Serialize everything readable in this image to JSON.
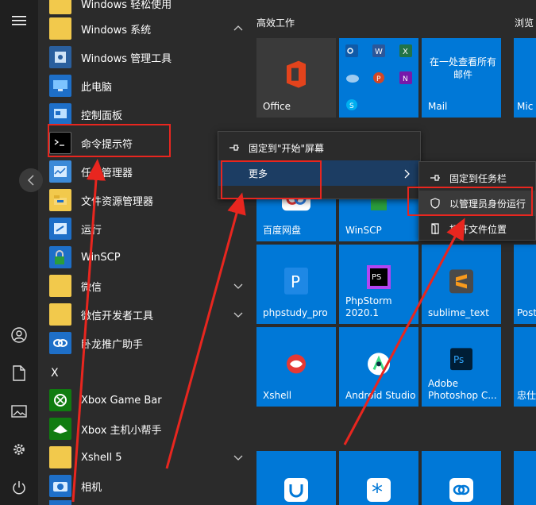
{
  "app_list": {
    "rows": [
      {
        "label": "Windows 轻松使用",
        "icon": "folder-icon"
      },
      {
        "label": "Windows 系统",
        "icon": "folder-icon",
        "chevron": "up"
      },
      {
        "label": "Windows 管理工具",
        "icon": "admin-tools-icon"
      },
      {
        "label": "此电脑",
        "icon": "computer-icon"
      },
      {
        "label": "控制面板",
        "icon": "control-panel-icon"
      },
      {
        "label": "命令提示符",
        "icon": "cmd-icon"
      },
      {
        "label": "任务管理器",
        "icon": "task-manager-icon"
      },
      {
        "label": "文件资源管理器",
        "icon": "file-explorer-icon"
      },
      {
        "label": "运行",
        "icon": "run-icon"
      },
      {
        "label": "WinSCP",
        "icon": "winscp-icon"
      },
      {
        "label": "微信",
        "icon": "folder-icon",
        "chevron": "down"
      },
      {
        "label": "微信开发者工具",
        "icon": "folder-icon",
        "chevron": "down"
      },
      {
        "label": "卧龙推广助手",
        "icon": "link-icon"
      },
      {
        "label": "Xbox Game Bar",
        "icon": "xbox-icon"
      },
      {
        "label": "Xbox 主机小帮手",
        "icon": "xbox-companion-icon"
      },
      {
        "label": "Xshell 5",
        "icon": "folder-icon",
        "chevron": "down"
      },
      {
        "label": "相机",
        "icon": "camera-icon"
      }
    ],
    "letter_x": "X"
  },
  "tiles": {
    "group1": "高效工作",
    "group2": "浏览",
    "office": "Office",
    "mail_text": "在一处查看所有邮件",
    "mail": "Mail",
    "mic": "Mic",
    "baidu": "百度网盘",
    "winscp": "WinSCP",
    "phpstudy": "phpstudy_pro",
    "phpstorm": "PhpStorm 2020.1",
    "sublime": "sublime_text",
    "post": "Post",
    "xshell": "Xshell",
    "android": "Android Studio",
    "photoshop": "Adobe Photoshop C...",
    "zhong": "忠仕"
  },
  "context_menu": {
    "pin_start": "固定到\"开始\"屏幕",
    "more": "更多"
  },
  "submenu": {
    "pin_taskbar": "固定到任务栏",
    "run_as_admin": "以管理员身份运行",
    "open_location": "打开文件位置"
  },
  "colors": {
    "accent": "#0078d7",
    "highlight_box": "#e8261f",
    "arrow": "#e8261f"
  }
}
